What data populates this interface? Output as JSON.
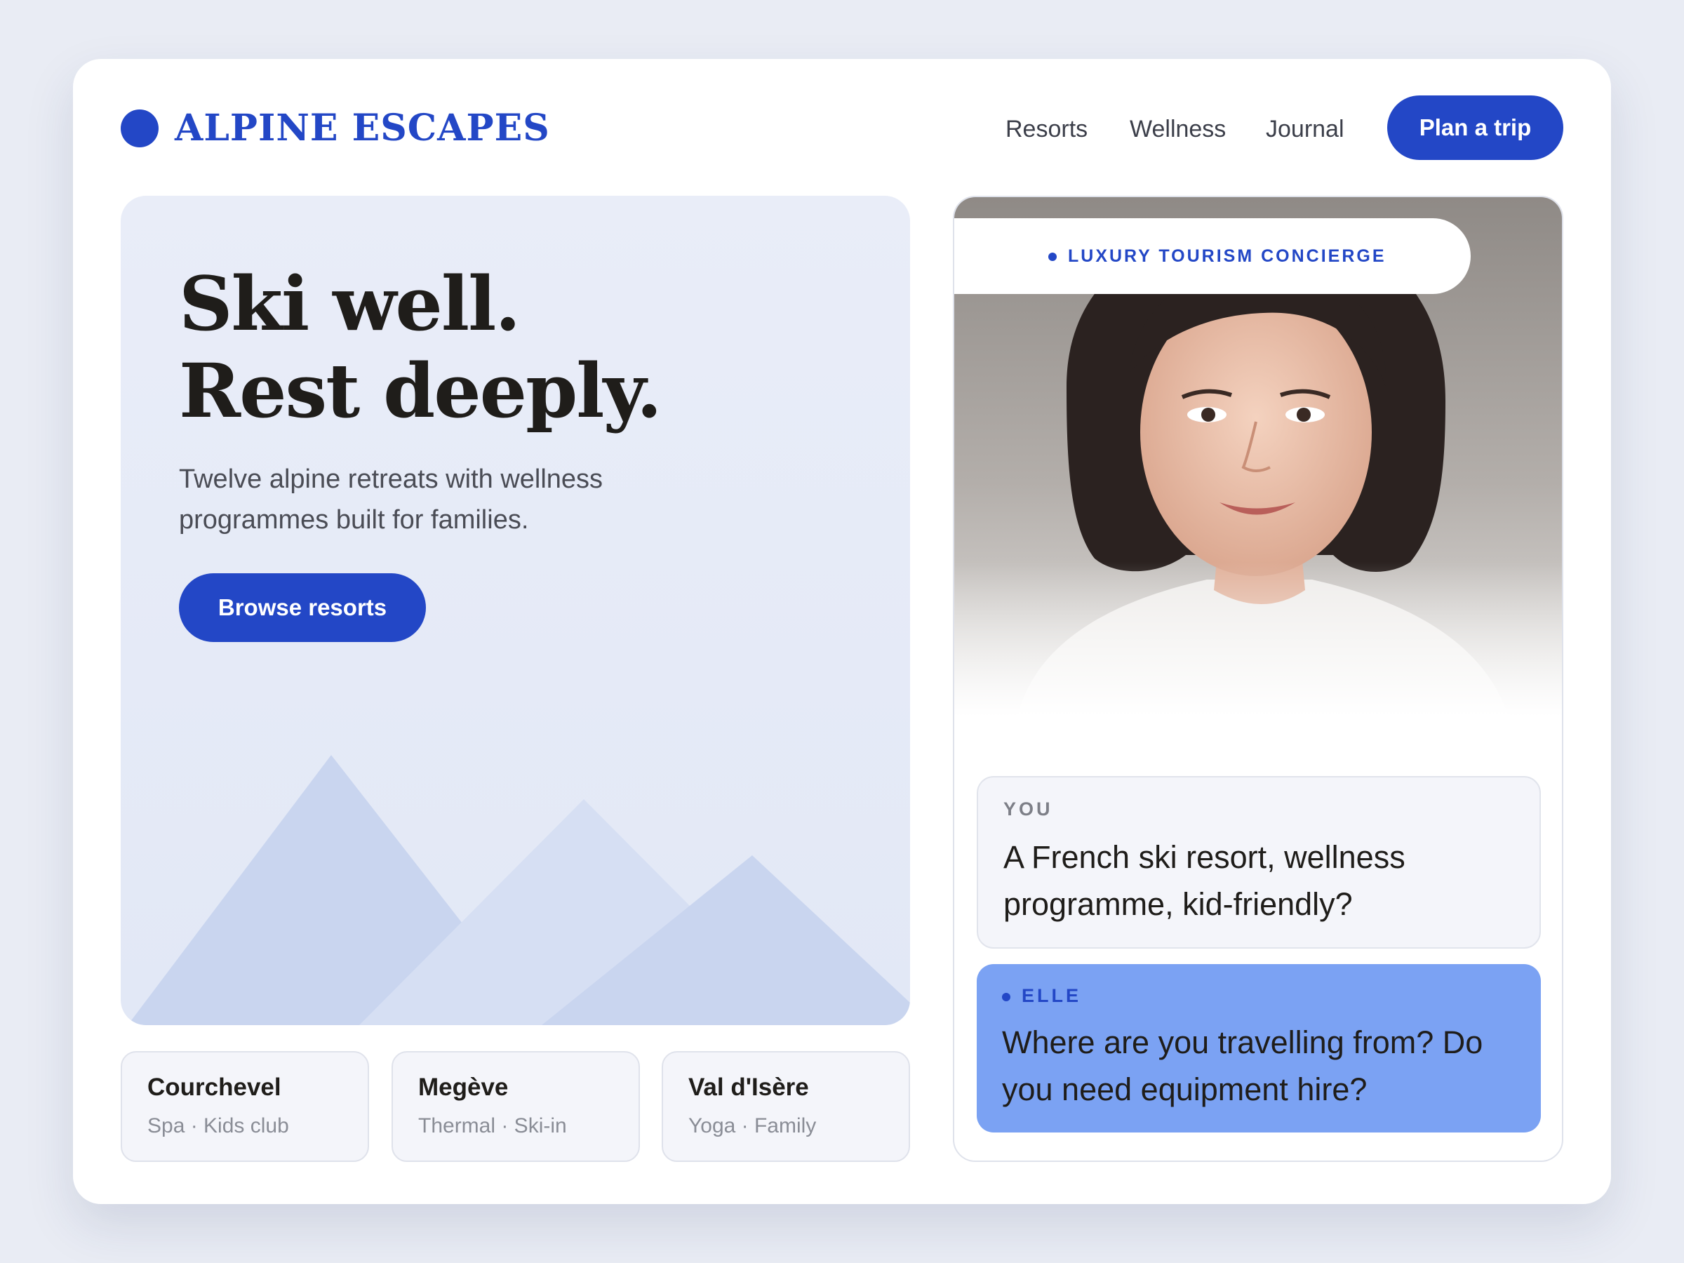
{
  "brand": {
    "name": "ALPINE ESCAPES",
    "color": "#2347c6"
  },
  "nav": {
    "items": [
      {
        "label": "Resorts"
      },
      {
        "label": "Wellness"
      },
      {
        "label": "Journal"
      }
    ],
    "cta_label": "Plan a trip"
  },
  "hero": {
    "title_line1": "Ski well.",
    "title_line2": "Rest deeply.",
    "subtitle": "Twelve alpine retreats with wellness programmes built for families.",
    "button_label": "Browse resorts"
  },
  "resorts": [
    {
      "name": "Courchevel",
      "tags": "Spa · Kids club"
    },
    {
      "name": "Megève",
      "tags": "Thermal · Ski-in"
    },
    {
      "name": "Val d'Isère",
      "tags": "Yoga · Family"
    }
  ],
  "concierge": {
    "badge": "LUXURY TOURISM CONCIERGE",
    "messages": [
      {
        "sender": "YOU",
        "text": "A French ski resort, wellness programme, kid-friendly?"
      },
      {
        "sender": "ELLE",
        "text": "Where are you travelling from? Do you need equipment hire?"
      }
    ]
  },
  "colors": {
    "accent": "#2347c6",
    "assistant_bubble": "#7ba2f3",
    "hero_bg": "#e9edf8",
    "page_bg": "#e9ecf4"
  }
}
